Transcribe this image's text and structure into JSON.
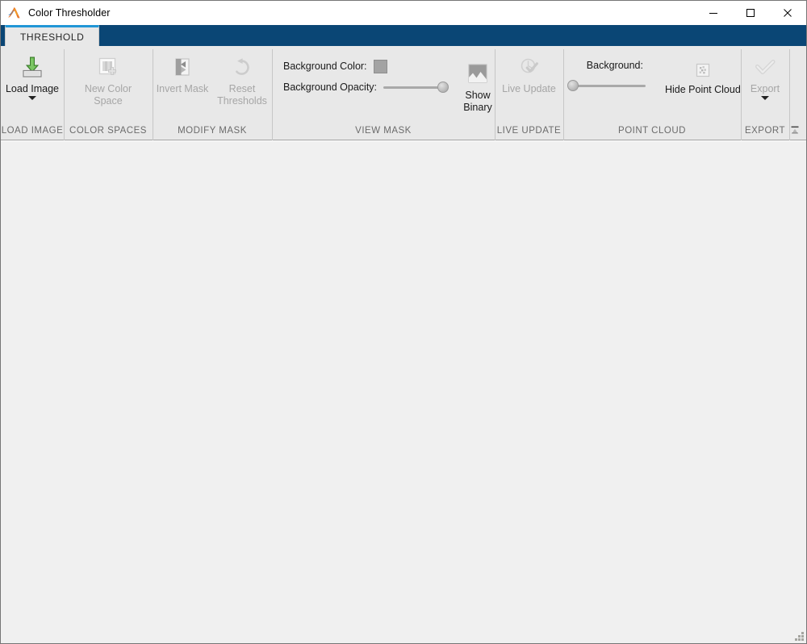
{
  "window": {
    "title": "Color Thresholder",
    "app_icon": "matlab-membrane-icon",
    "minimize_label": "Minimize",
    "maximize_label": "Maximize",
    "close_label": "Close"
  },
  "ribbon": {
    "tabs": [
      {
        "label": "THRESHOLD",
        "selected": true
      }
    ],
    "collapse_label": "Collapse Ribbon",
    "sections": [
      {
        "title": "LOAD IMAGE",
        "items": [
          {
            "label": "Load Image",
            "icon": "load-image-icon",
            "enabled": true,
            "has_dropdown": true
          }
        ]
      },
      {
        "title": "COLOR SPACES",
        "items": [
          {
            "label": "New Color Space",
            "icon": "new-color-space-icon",
            "enabled": false,
            "has_dropdown": false
          }
        ]
      },
      {
        "title": "MODIFY MASK",
        "items": [
          {
            "label": "Invert Mask",
            "icon": "invert-mask-icon",
            "enabled": false,
            "has_dropdown": false
          },
          {
            "label": "Reset Thresholds",
            "icon": "reset-thresholds-icon",
            "enabled": false,
            "has_dropdown": false
          }
        ]
      },
      {
        "title": "VIEW MASK",
        "background_color_label": "Background Color:",
        "background_color_value": "#a3a3a3",
        "background_opacity_label": "Background Opacity:",
        "background_opacity_value": "100",
        "show_binary_label": "Show Binary",
        "show_binary_icon": "show-binary-icon"
      },
      {
        "title": "LIVE UPDATE",
        "items": [
          {
            "label": "Live Update",
            "icon": "live-update-icon",
            "enabled": false,
            "has_dropdown": false
          }
        ]
      },
      {
        "title": "POINT CLOUD",
        "background_label": "Background:",
        "background_value": "0",
        "hide_point_cloud_label": "Hide Point Cloud",
        "hide_point_cloud_icon": "point-cloud-icon"
      },
      {
        "title": "EXPORT",
        "items": [
          {
            "label": "Export",
            "icon": "export-icon",
            "enabled": false,
            "has_dropdown": true
          }
        ]
      }
    ]
  },
  "canvas": {
    "content": "",
    "background_color": "#f0f0f0"
  },
  "colors": {
    "tab_bar": "#0a4675",
    "tab_accent": "#2196d6",
    "ribbon_bg": "#e8e8e8",
    "section_title": "#6b6b6b",
    "disabled_text": "#a6a6a6"
  }
}
